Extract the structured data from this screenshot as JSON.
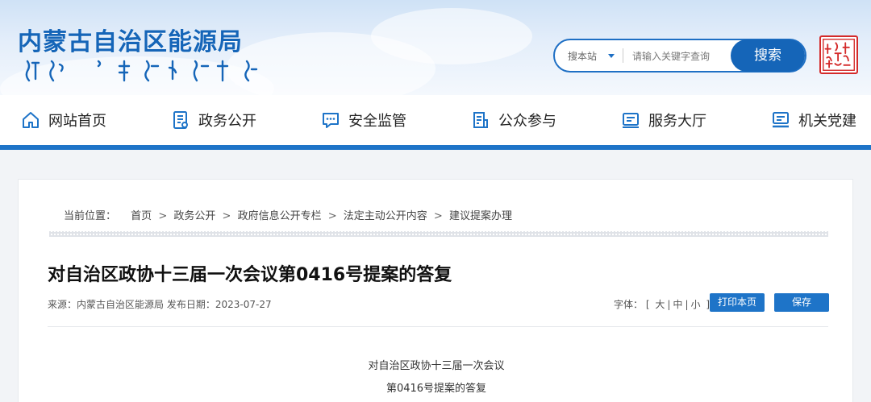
{
  "header": {
    "site_title": "内蒙古自治区能源局",
    "search": {
      "scope_label": "搜本站",
      "placeholder": "请输入关键字查询",
      "button_label": "搜索"
    },
    "seal_text": "内蒙古",
    "colors": {
      "brand_blue": "#1565b8",
      "nav_bar": "#1e74c8",
      "seal_red": "#d42a2a"
    }
  },
  "nav": {
    "items": [
      {
        "label": "网站首页",
        "icon": "home-icon"
      },
      {
        "label": "政务公开",
        "icon": "document-list-icon"
      },
      {
        "label": "安全监管",
        "icon": "chat-bubble-icon"
      },
      {
        "label": "公众参与",
        "icon": "clipboard-icon"
      },
      {
        "label": "服务大厅",
        "icon": "id-card-icon"
      },
      {
        "label": "机关党建",
        "icon": "monitor-icon"
      }
    ]
  },
  "breadcrumb": {
    "label": "当前位置：",
    "items": [
      "首页",
      "政务公开",
      "政府信息公开专栏",
      "法定主动公开内容",
      "建议提案办理"
    ],
    "separator": ">"
  },
  "article": {
    "title": "对自治区政协十三届一次会议第0416号提案的答复",
    "source_label": "来源：",
    "source": "内蒙古自治区能源局",
    "date_label": "发布日期：",
    "date": "2023-07-27",
    "font_label": "字体：",
    "font_open": "[",
    "font_close": "]",
    "font_sizes": [
      "大",
      "中",
      "小"
    ],
    "print_label": "打印本页",
    "save_label": "保存",
    "body_lines": [
      "对自治区政协十三届一次会议",
      "第0416号提案的答复"
    ]
  }
}
